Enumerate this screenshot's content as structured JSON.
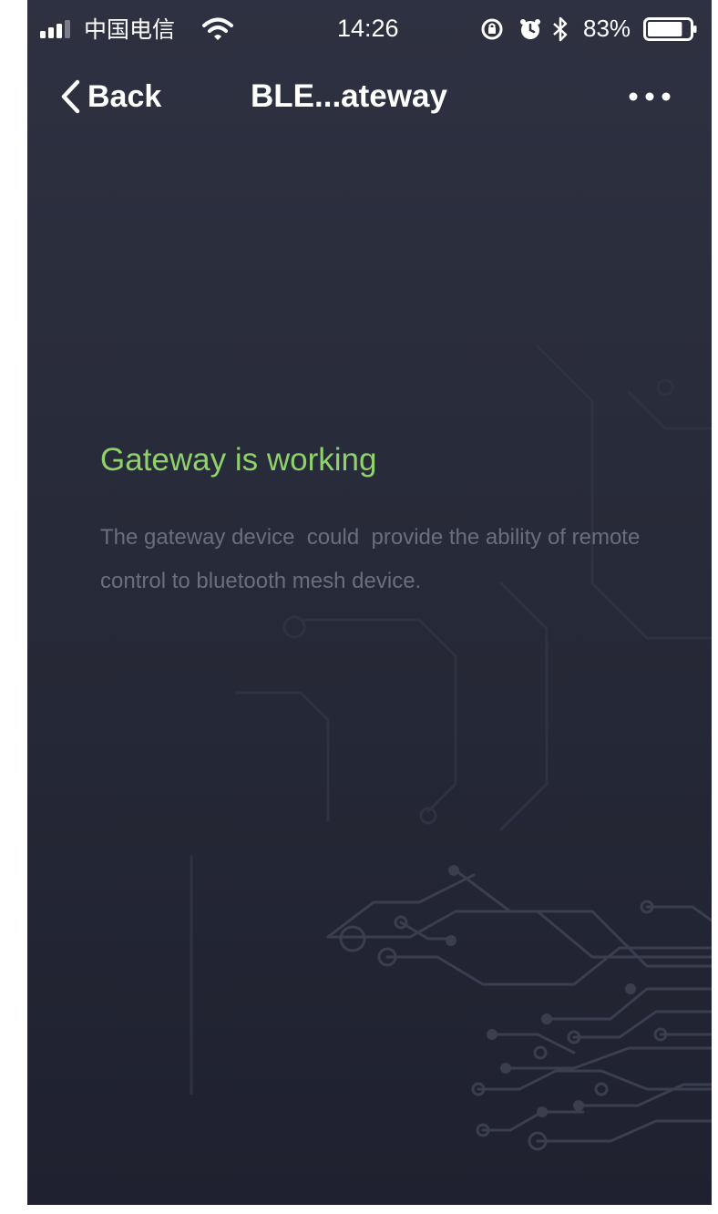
{
  "status_bar": {
    "carrier": "中国电信",
    "time": "14:26",
    "battery_percent": "83%",
    "battery_level": 0.83,
    "icons": [
      "signal-icon",
      "wifi-icon",
      "orientation-lock-icon",
      "alarm-icon",
      "bluetooth-icon",
      "battery-icon"
    ]
  },
  "nav": {
    "back_label": "Back",
    "title": "BLE...ateway",
    "more_icon": "more-dots-icon"
  },
  "content": {
    "heading": "Gateway is working",
    "description": "The gateway device  could  provide the ability of remote control to bluetooth mesh device."
  },
  "colors": {
    "background_top": "#2e3141",
    "background_bottom": "#1f2130",
    "heading_green": "#8fd16a",
    "description_gray": "#6b6f7d",
    "text_white": "#ffffff"
  }
}
